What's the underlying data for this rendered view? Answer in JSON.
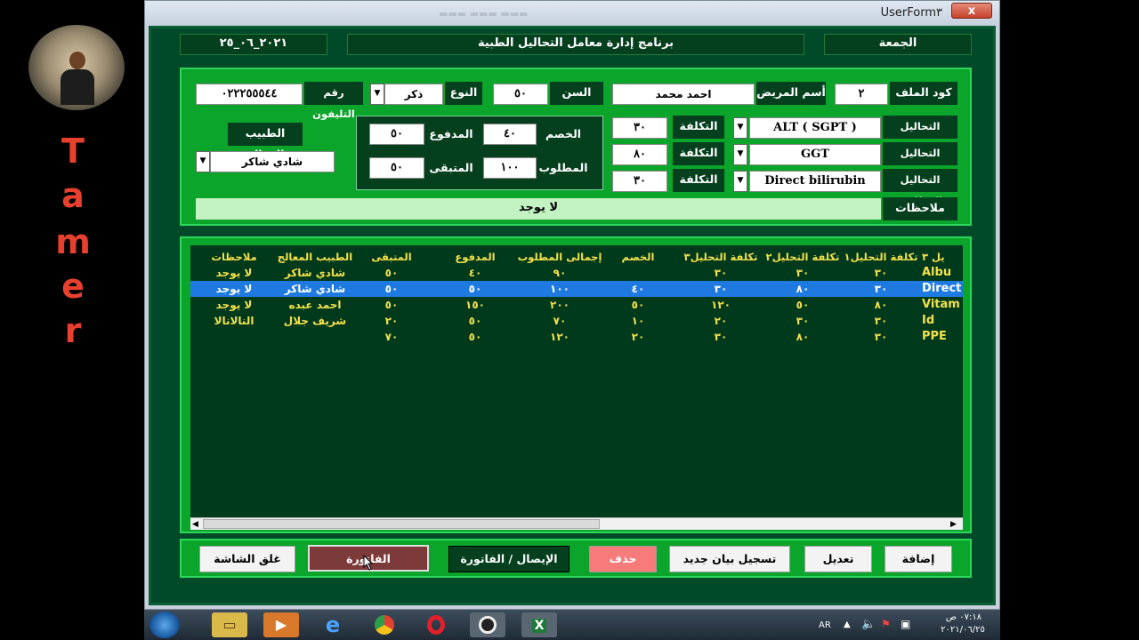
{
  "overlay": {
    "letters": [
      "T",
      "a",
      "m",
      "e",
      "r"
    ]
  },
  "window": {
    "title": "UserForm٣",
    "close": "x"
  },
  "header": {
    "date": "٢٠٢١_٠٦_٢٥",
    "app_title": "برنامج إدارة معامل التحاليل الطبية",
    "day": "الجمعة"
  },
  "form": {
    "file_code_label": "كود الملف",
    "file_code": "٢",
    "patient_name_label": "أسم المريض",
    "patient_name": "احمد محمد",
    "age_label": "السن",
    "age": "٥٠",
    "gender_label": "النوع",
    "gender": "ذكر",
    "phone_label": "رقم التليفون",
    "phone": "٠٢٢٢٥٥٥٤٤",
    "tests_label": "التحاليل المطلوبة",
    "cost_label": "التكلفة",
    "tests": [
      {
        "name": "ALT ( SGPT )",
        "cost": "٣٠"
      },
      {
        "name": "GGT",
        "cost": "٨٠"
      },
      {
        "name": "Direct bilirubin",
        "cost": "٣٠"
      }
    ],
    "discount_label": "الخصم",
    "discount": "٤٠",
    "paid_label": "المدفوع",
    "paid": "٥٠",
    "required_label": "المطلوب",
    "required": "١٠٠",
    "remaining_label": "المتبقى",
    "remaining": "٥٠",
    "doctor_label": "الطبيب المعالج",
    "doctor": "شادي شاكر",
    "notes_label": "ملاحظات",
    "notes": "لا يوجد"
  },
  "table": {
    "columns": [
      "يل ٣",
      "تكلفة التحليل١",
      "تكلفة التحليل٢",
      "تكلفة التحليل٣",
      "الخصم",
      "إجمالى المطلوب",
      "المدفوع",
      "المتبقى",
      "الطبيب المعالج",
      "ملاحظات"
    ],
    "rows": [
      [
        "Albu",
        "٣٠",
        "٣٠",
        "٣٠",
        "",
        "٩٠",
        "٤٠",
        "٥٠",
        "شادي شاكر",
        "لا يوجد"
      ],
      [
        "Direct",
        "٣٠",
        "٨٠",
        "٣٠",
        "٤٠",
        "١٠٠",
        "٥٠",
        "٥٠",
        "شادي شاكر",
        "لا يوجد"
      ],
      [
        "Vitam",
        "٨٠",
        "٥٠",
        "١٢٠",
        "٥٠",
        "٢٠٠",
        "١٥٠",
        "٥٠",
        "احمد عبده",
        "لا يوجد"
      ],
      [
        "Id",
        "٣٠",
        "٣٠",
        "٢٠",
        "١٠",
        "٧٠",
        "٥٠",
        "٢٠",
        "شريف جلال",
        "النالانالا"
      ],
      [
        "PPE",
        "٣٠",
        "٨٠",
        "٣٠",
        "٢٠",
        "١٢٠",
        "٥٠",
        "٧٠",
        "",
        ""
      ]
    ],
    "selected_index": 1
  },
  "buttons": {
    "add": "إضافة",
    "edit": "تعديل",
    "new_record": "تسجيل بيان جديد",
    "delete": "حذف",
    "receipt_invoice": "الإيصال / الفاتورة",
    "invoice": "الفاتورة",
    "close_screen": "غلق الشاشة"
  },
  "taskbar": {
    "lang": "AR",
    "time": "٠٧:١٨ ص",
    "date": "٢٠٢١/٠٦/٢٥"
  }
}
